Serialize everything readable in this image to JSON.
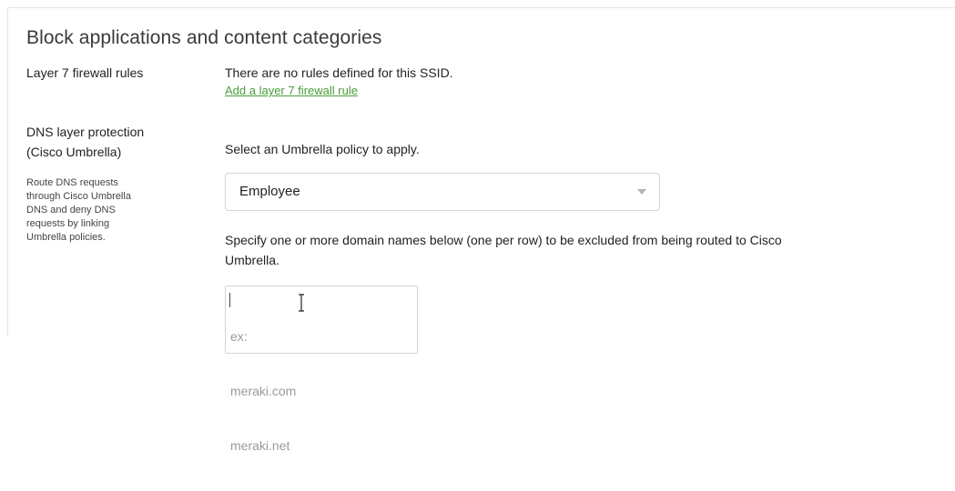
{
  "section": {
    "title": "Block applications and content categories"
  },
  "layer7": {
    "label": "Layer 7 firewall rules",
    "no_rules_text": "There are no rules defined for this SSID.",
    "add_link": "Add a layer 7 firewall rule"
  },
  "dns": {
    "label_line1": "DNS layer protection",
    "label_line2": "(Cisco Umbrella)",
    "description_lines": [
      "Route DNS requests",
      "through Cisco Umbrella",
      "DNS and deny DNS",
      "requests by linking",
      "Umbrella policies."
    ],
    "select_prompt": "Select an Umbrella policy to apply.",
    "policy_select": {
      "selected_value": "Employee"
    },
    "specify_line1": "Specify one or more domain names below (one per row) to be excluded from being routed to Cisco",
    "specify_line2": "Umbrella.",
    "exclusions_textarea": {
      "placeholder_lines": [
        "ex:",
        "meraki.com",
        "meraki.net"
      ]
    }
  },
  "icons": {
    "select_chevron": "chevron-down-icon",
    "text_cursor": "ibeam-cursor-icon"
  },
  "colors": {
    "link": "#4a9d3a",
    "border": "#d4d4d4",
    "placeholder": "#9a9a9a"
  }
}
